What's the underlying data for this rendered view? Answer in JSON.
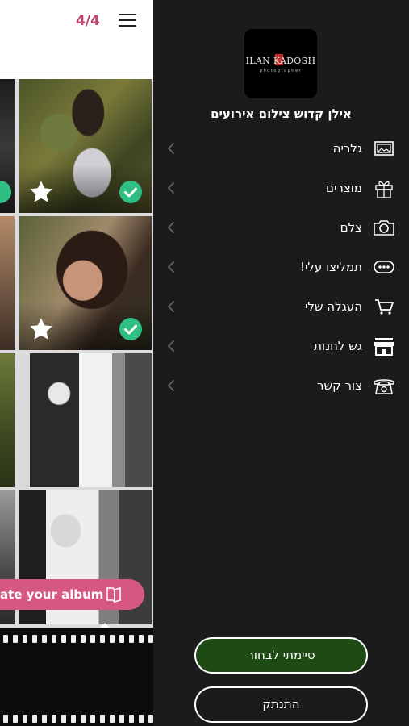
{
  "header": {
    "counter": "4/4"
  },
  "gallery": {
    "cta_label": "ate your album"
  },
  "drawer": {
    "logo_text": "ILAN KADOSH",
    "logo_subtext": "photographer",
    "business_name": "אילן קדוש צילום אירועים",
    "items": [
      {
        "label": "גלריה",
        "icon": "gallery-icon"
      },
      {
        "label": "מוצרים",
        "icon": "gift-icon"
      },
      {
        "label": "צלם",
        "icon": "camera-icon"
      },
      {
        "label": "תמליצו עלי!",
        "icon": "chat-bubble-icon"
      },
      {
        "label": "העגלה שלי",
        "icon": "cart-icon"
      },
      {
        "label": "גש לחנות",
        "icon": "store-icon"
      },
      {
        "label": "צור קשר",
        "icon": "phone-icon"
      }
    ],
    "done_button": "סיימתי לבחור",
    "logout_button": "התנתק"
  },
  "colors": {
    "accent_pink": "#d6577f",
    "counter_pink": "#c0446f",
    "check_green": "#2fbf84",
    "done_button_green": "#1e4a14",
    "drawer_bg": "#1b1b1d"
  }
}
